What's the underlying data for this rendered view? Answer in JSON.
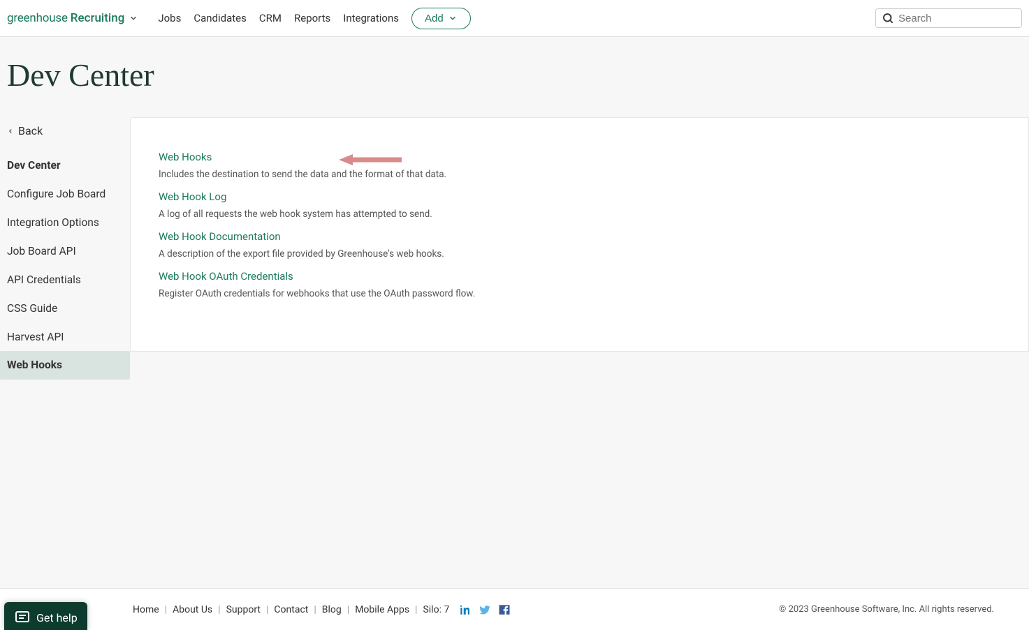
{
  "header": {
    "logo_text_a": "greenhouse",
    "logo_text_b": "Recruiting",
    "nav": [
      "Jobs",
      "Candidates",
      "CRM",
      "Reports",
      "Integrations"
    ],
    "add_label": "Add",
    "search_placeholder": "Search"
  },
  "page": {
    "title": "Dev Center"
  },
  "sidebar": {
    "back_label": "Back",
    "items": [
      {
        "label": "Dev Center",
        "bold": true,
        "active": false
      },
      {
        "label": "Configure Job Board",
        "bold": false,
        "active": false
      },
      {
        "label": "Integration Options",
        "bold": false,
        "active": false
      },
      {
        "label": "Job Board API",
        "bold": false,
        "active": false
      },
      {
        "label": "API Credentials",
        "bold": false,
        "active": false
      },
      {
        "label": "CSS Guide",
        "bold": false,
        "active": false
      },
      {
        "label": "Harvest API",
        "bold": false,
        "active": false
      },
      {
        "label": "Web Hooks",
        "bold": true,
        "active": true
      }
    ]
  },
  "content": {
    "links": [
      {
        "title": "Web Hooks",
        "desc": "Includes the destination to send the data and the format of that data."
      },
      {
        "title": "Web Hook Log",
        "desc": "A log of all requests the web hook system has attempted to send."
      },
      {
        "title": "Web Hook Documentation",
        "desc": "A description of the export file provided by Greenhouse's web hooks."
      },
      {
        "title": "Web Hook OAuth Credentials",
        "desc": "Register OAuth credentials for webhooks that use the OAuth password flow."
      }
    ]
  },
  "footer": {
    "links": [
      "Home",
      "About Us",
      "Support",
      "Contact",
      "Blog",
      "Mobile Apps",
      "Silo: 7"
    ],
    "copyright": "© 2023 Greenhouse Software, Inc. All rights reserved."
  },
  "help": {
    "label": "Get help"
  }
}
